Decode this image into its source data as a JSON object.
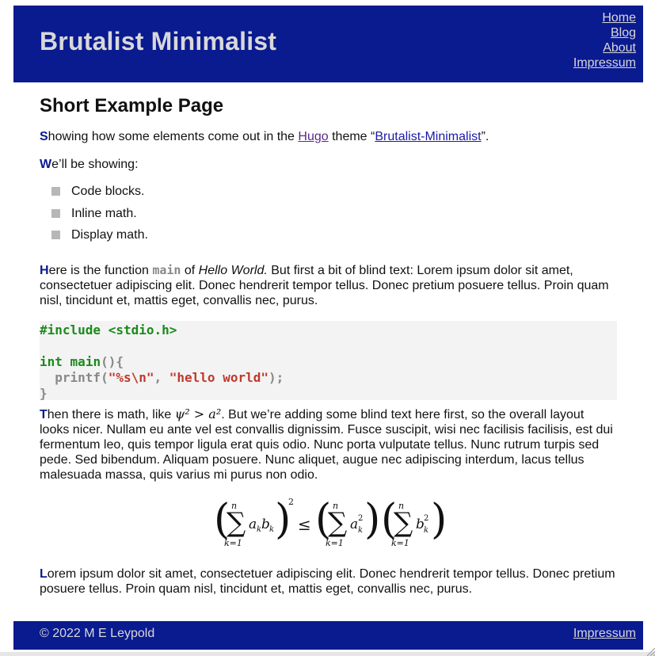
{
  "header": {
    "site_title": "Brutalist Minimalist",
    "nav": [
      "Home",
      "Blog",
      "About",
      "Impressum"
    ]
  },
  "main": {
    "page_title": "Short Example Page",
    "p1": {
      "cap": "S",
      "text_a": "howing how some elements come out in the ",
      "link1": "Hugo",
      "text_b": " theme “",
      "link2": "Brutalist-Minimalist",
      "text_c": "”."
    },
    "p2": {
      "cap": "W",
      "text": "e’ll be showing:"
    },
    "list": [
      "Code blocks.",
      "Inline math.",
      "Display math."
    ],
    "p3": {
      "cap": "H",
      "text_a": "ere is the function ",
      "code": "main",
      "text_b": " of ",
      "em": "Hello World.",
      "text_c": " But first a bit of blind text: Lorem ipsum dolor sit amet, consectetuer adipiscing elit. Donec hendrerit tempor tellus. Donec pretium posuere tellus. Proin quam nisl, tincidunt et, mattis eget, convallis nec, purus."
    },
    "code": {
      "line1": "#include <stdio.h>",
      "line3_kw": "int",
      "line3_fn": "main",
      "line3_rest": "(){",
      "line4_fn": "printf(",
      "line4_s1": "\"%s\\n\"",
      "line4_sep": ", ",
      "line4_s2": "\"hello world\"",
      "line4_end": ");",
      "line5": "}"
    },
    "p4": {
      "cap": "T",
      "text_a": "hen there is math, like ",
      "math": "ψ² > a²",
      "text_b": ". But we’re adding some blind text here first, so the overall layout looks nicer. Nullam eu ante vel est convallis dignissim. Fusce suscipit, wisi nec facilisis facilisis, est dui fermentum leo, quis tempor ligula erat quis odio. Nunc porta vulputate tellus. Nunc rutrum turpis sed pede. Sed bibendum. Aliquam posuere. Nunc aliquet, augue nec adipiscing interdum, lacus tellus malesuada massa, quis varius mi purus non odio."
    },
    "display_math": "(Σ_{k=1}^{n} a_k b_k)^2 ≤ (Σ_{k=1}^{n} a_k^2)(Σ_{k=1}^{n} b_k^2)",
    "p5": {
      "cap": "L",
      "text": "orem ipsum dolor sit amet, consectetuer adipiscing elit. Donec hendrerit tempor tellus. Donec pretium posuere tellus. Proin quam nisl, tincidunt et, mattis eget, convallis nec, purus."
    }
  },
  "footer": {
    "copyright": "© 2022 M E Leypold",
    "impressum": "Impressum"
  },
  "colors": {
    "brand": "#0a1a8f",
    "header_text": "#d8d8d8",
    "bullet": "#b7b7b7",
    "code_bg": "#f3f3f3"
  }
}
